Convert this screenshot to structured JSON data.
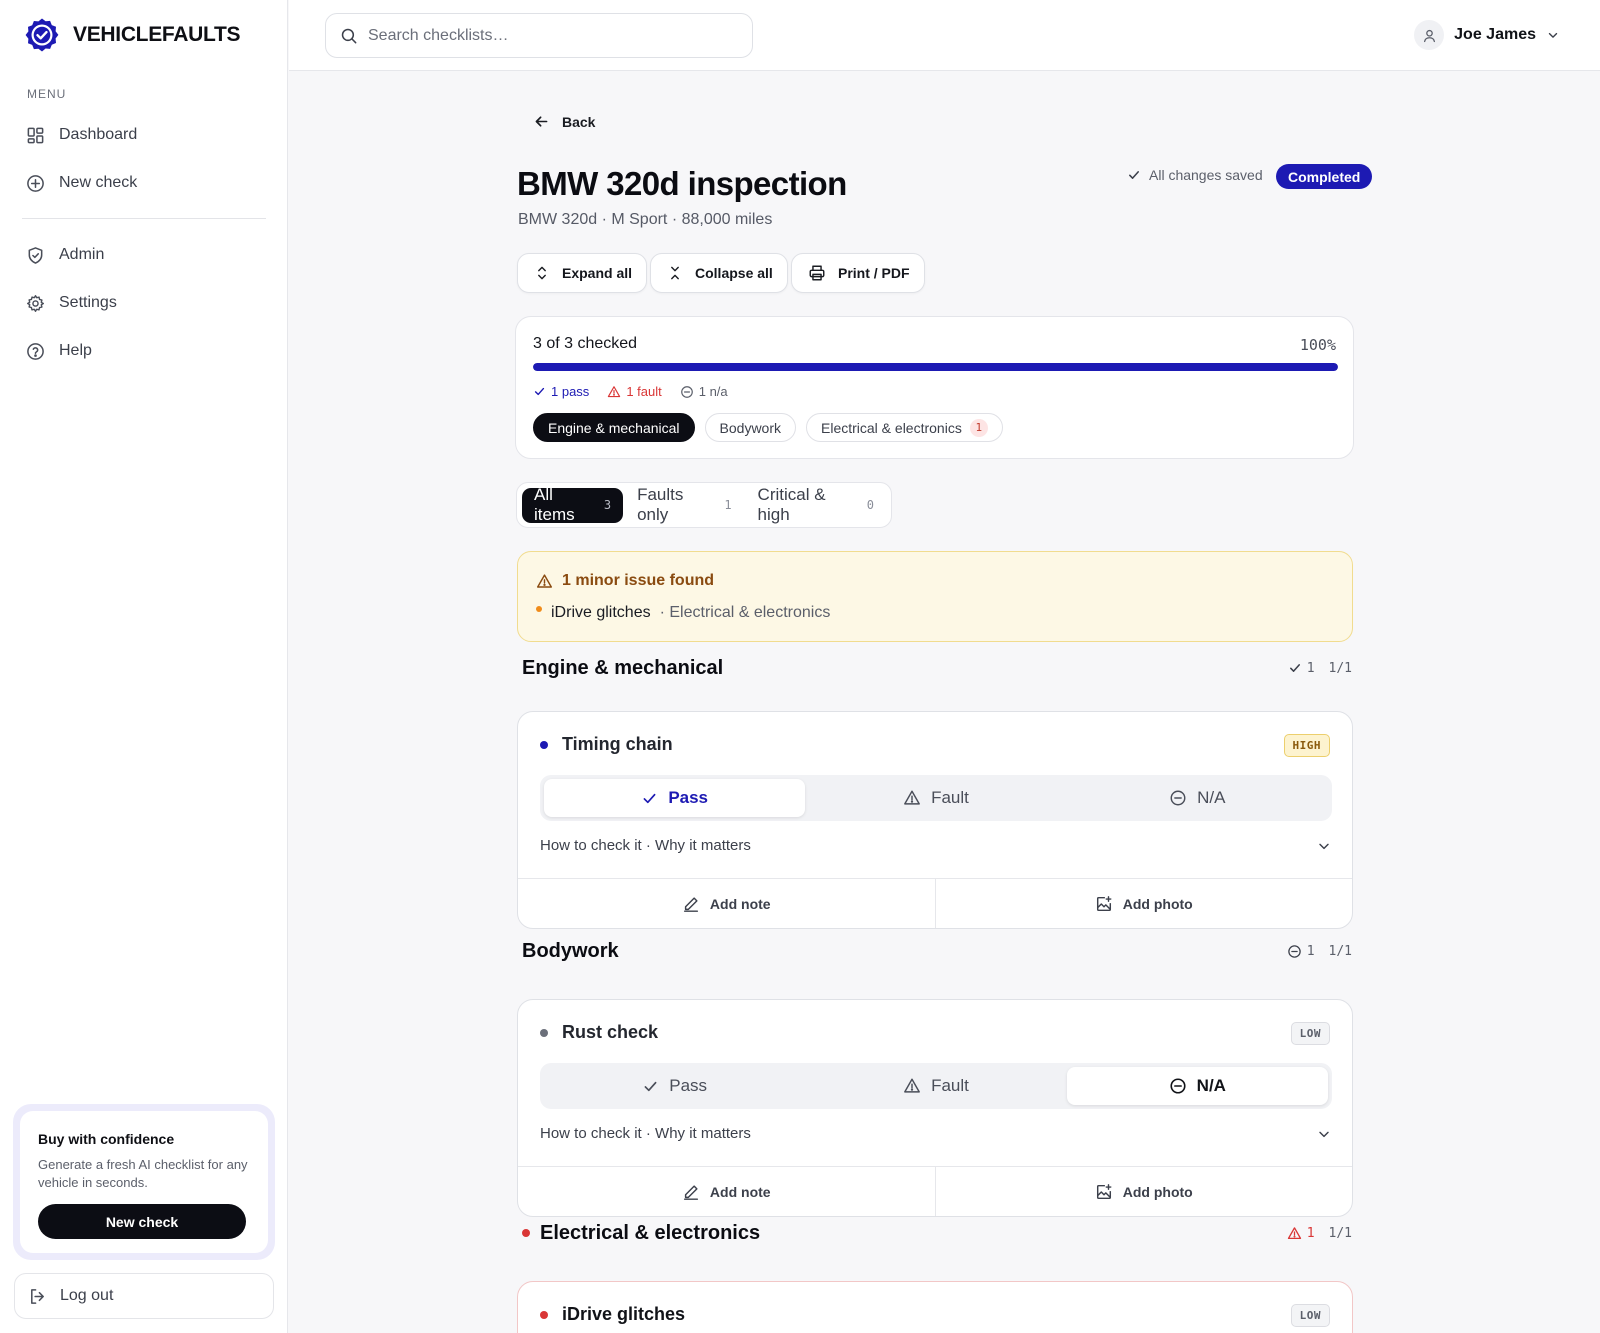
{
  "brand": {
    "name": "VEHICLEFAULTS",
    "logo_icon": "badge-check-icon",
    "accent": "#1d1ab3"
  },
  "sidebar": {
    "menu_label": "MENU",
    "primary_items": [
      {
        "label": "Dashboard",
        "icon": "dashboard-icon"
      },
      {
        "label": "New check",
        "icon": "plus-circle-icon"
      }
    ],
    "secondary_items": [
      {
        "label": "Admin",
        "icon": "shield-icon"
      },
      {
        "label": "Settings",
        "icon": "gear-icon"
      },
      {
        "label": "Help",
        "icon": "help-circle-icon"
      }
    ],
    "promo": {
      "title": "Buy with confidence",
      "text": "Generate a fresh AI checklist for any vehicle in seconds.",
      "button": "New check"
    },
    "logout": "Log out"
  },
  "topbar": {
    "search_placeholder": "Search checklists…",
    "user_name": "Joe James"
  },
  "page": {
    "back": "Back",
    "title": "BMW 320d inspection",
    "subtitle": "BMW 320d · M Sport · 88,000 miles",
    "saved_status": "All changes saved",
    "status_badge": "Completed",
    "toolbar": {
      "expand": "Expand all",
      "collapse": "Collapse all",
      "print": "Print / PDF"
    }
  },
  "progress": {
    "text": "3 of 3 checked",
    "percent_label": "100%",
    "fraction": 1.0,
    "pass": "1 pass",
    "fault": "1 fault",
    "na": "1 n/a",
    "colors": {
      "pass": "#1d1ab3",
      "fault": "#d93636",
      "na": "#5b5f6a"
    },
    "category_pills": [
      {
        "label": "Engine & mechanical",
        "active": true,
        "count": ""
      },
      {
        "label": "Bodywork",
        "active": false,
        "count": ""
      },
      {
        "label": "Electrical & electronics",
        "active": false,
        "count": "1"
      }
    ]
  },
  "filters": [
    {
      "label": "All items",
      "count": "3",
      "active": true
    },
    {
      "label": "Faults only",
      "count": "1",
      "active": false
    },
    {
      "label": "Critical & high",
      "count": "0",
      "active": false
    }
  ],
  "issues": {
    "title": "1 minor issue found",
    "items": [
      {
        "name": "iDrive glitches",
        "category": "· Electrical & electronics"
      }
    ]
  },
  "sections": [
    {
      "title": "Engine & mechanical",
      "status_icon": "check-icon",
      "status_count": "1",
      "fraction": "1/1",
      "items": [
        {
          "name": "Timing chain",
          "severity": "HIGH",
          "dot_color": "#1d1ab3",
          "selected": "Pass",
          "pass": "Pass",
          "fault": "Fault",
          "na": "N/A",
          "howto": "How to check it · Why it matters",
          "note": "Add note",
          "photo": "Add photo"
        }
      ]
    },
    {
      "title": "Bodywork",
      "status_icon": "minus-circle-icon",
      "status_count": "1",
      "fraction": "1/1",
      "items": [
        {
          "name": "Rust check",
          "severity": "LOW",
          "dot_color": "#6b6f7a",
          "selected": "N/A",
          "pass": "Pass",
          "fault": "Fault",
          "na": "N/A",
          "howto": "How to check it · Why it matters",
          "note": "Add note",
          "photo": "Add photo"
        }
      ]
    },
    {
      "title": "Electrical & electronics",
      "status_icon": "alert-triangle-icon",
      "status_count": "1",
      "fraction": "1/1",
      "items": [
        {
          "name": "iDrive glitches",
          "severity": "LOW",
          "dot_color": "#d93636",
          "selected": "Fault"
        }
      ]
    }
  ]
}
